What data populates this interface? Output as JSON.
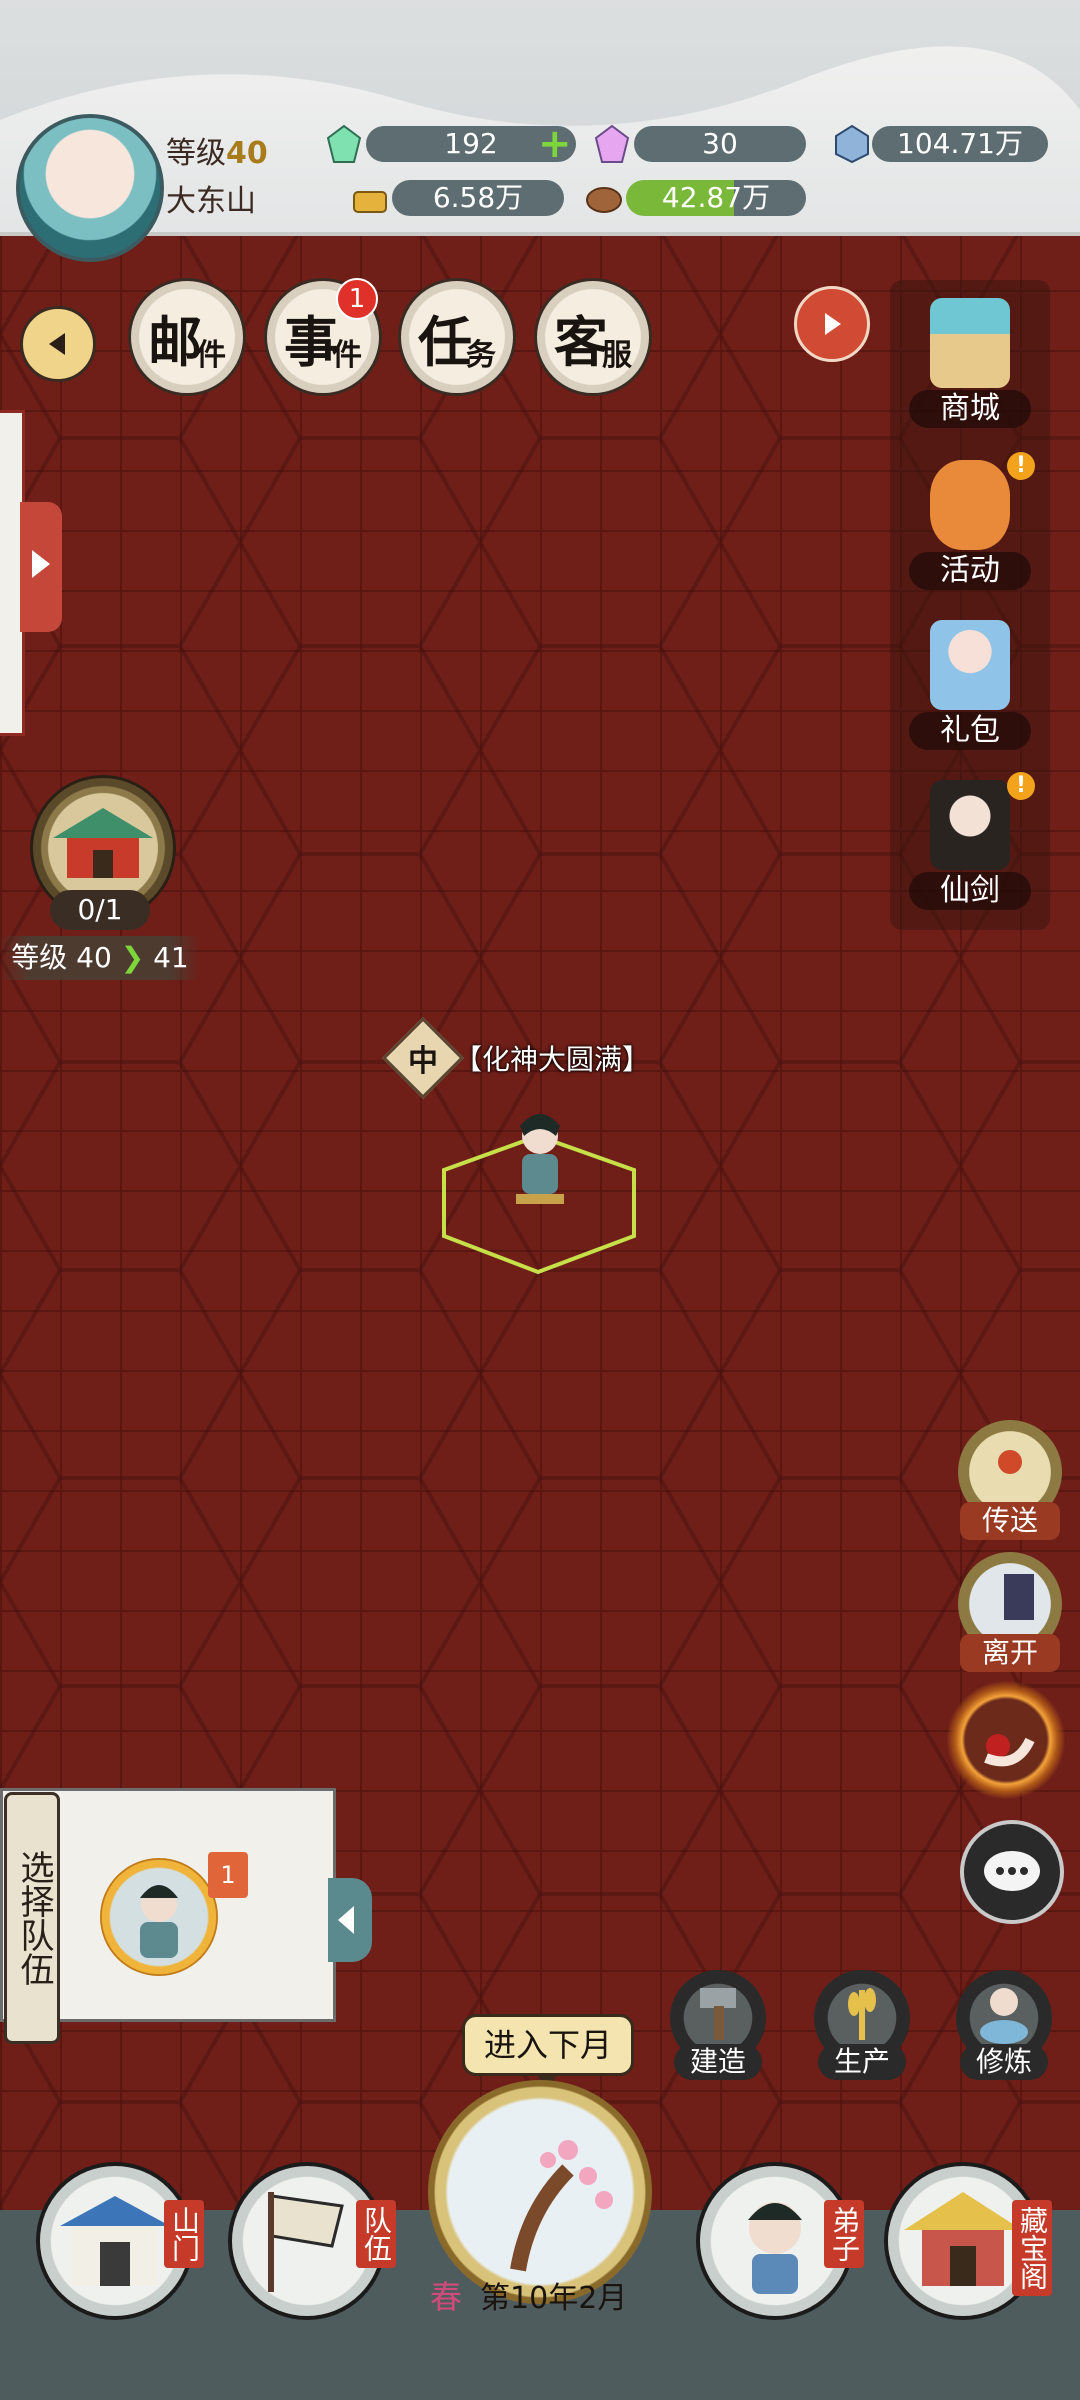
{
  "player": {
    "level_label": "等级",
    "level": "40",
    "sect": "大东山"
  },
  "resources": {
    "crystal": "192",
    "rainbow": "30",
    "gem": "104.71万",
    "gold": "6.58万",
    "wood": "42.87万"
  },
  "tabs": [
    {
      "big": "邮",
      "small": "件"
    },
    {
      "big": "事",
      "small": "件",
      "badge": "1"
    },
    {
      "big": "任",
      "small": "务"
    },
    {
      "big": "客",
      "small": "服"
    }
  ],
  "right_menu": [
    {
      "label": "商城"
    },
    {
      "label": "活动",
      "alert": "!"
    },
    {
      "label": "礼包"
    },
    {
      "label": "仙剑",
      "alert": "!"
    }
  ],
  "gate": {
    "count": "0/1",
    "level_from": "等级 40",
    "level_to": "41"
  },
  "character": {
    "mark": "中",
    "realm": "【化神大圆满】"
  },
  "side_actions": [
    {
      "label": "传送"
    },
    {
      "label": "离开"
    }
  ],
  "build_actions": [
    {
      "label": "建造"
    },
    {
      "label": "生产"
    },
    {
      "label": "修炼"
    }
  ],
  "team": {
    "select_label": "选择队伍",
    "flag": "1"
  },
  "next_month": "进入下月",
  "calendar": {
    "season": "春",
    "date": "第10年2月"
  },
  "bottom_nav": [
    {
      "label": "山门"
    },
    {
      "label": "队伍"
    },
    {
      "label": "弟子"
    },
    {
      "label": "藏宝阁"
    }
  ],
  "colors": {
    "board": "#6f1f18",
    "accent_green": "#7cd63b",
    "alert": "#e0302a"
  }
}
